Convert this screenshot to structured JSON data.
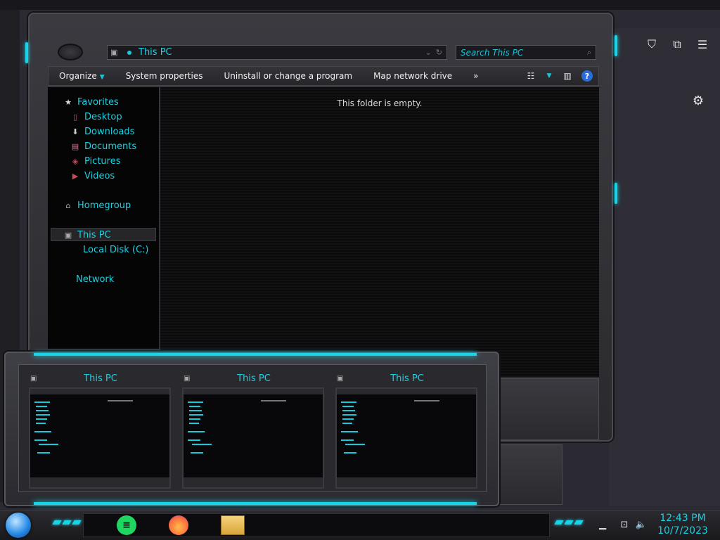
{
  "window": {
    "title": "This PC",
    "address": "This PC",
    "search_placeholder": "Search This PC"
  },
  "toolbar": {
    "organize": "Organize",
    "system_properties": "System properties",
    "uninstall": "Uninstall or change a program",
    "map_drive": "Map network drive",
    "more": "»"
  },
  "nav": {
    "favorites": "Favorites",
    "desktop": "Desktop",
    "downloads": "Downloads",
    "documents": "Documents",
    "pictures": "Pictures",
    "videos": "Videos",
    "homegroup": "Homegroup",
    "this_pc": "This PC",
    "local_disk": "Local Disk (C:)",
    "network": "Network"
  },
  "content": {
    "empty_message": "This folder is empty."
  },
  "thumbnails": [
    {
      "title": "This PC"
    },
    {
      "title": "This PC"
    },
    {
      "title": "This PC"
    }
  ],
  "taskbar": {
    "time": "12:43 PM",
    "date": "10/7/2023"
  },
  "colors": {
    "accent": "#19d3e6",
    "text_cyan": "#17d2e4"
  }
}
